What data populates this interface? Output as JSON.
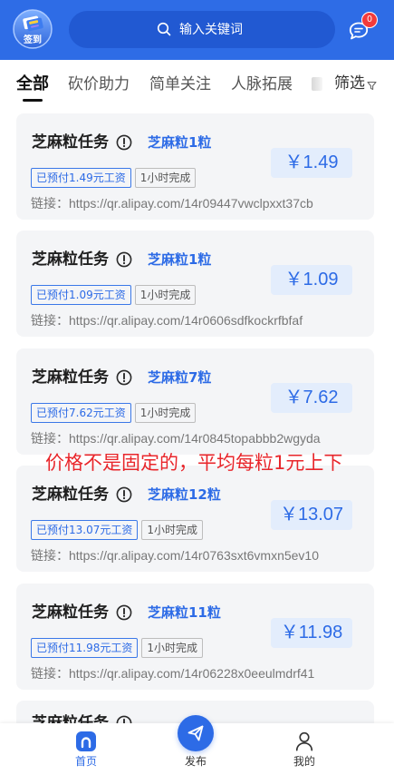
{
  "header": {
    "checkin_label": "签到",
    "search_placeholder": "输入关键词",
    "message_badge": "0",
    "icons": [
      "checkin-icon",
      "search-icon",
      "message-icon"
    ]
  },
  "tabs": {
    "items": [
      {
        "label": "全部",
        "active": true
      },
      {
        "label": "砍价助力"
      },
      {
        "label": "简单关注"
      },
      {
        "label": "人脉拓展"
      }
    ],
    "filter_label": "筛选"
  },
  "cards": [
    {
      "title": "芝麻粒任务",
      "reward": "芝麻粒1粒",
      "prepaid": "已预付1.49元工资",
      "duration": "1小时完成",
      "link_label": "链接：",
      "link_url": "https://qr.alipay.com/14r09447vwclpxxt37cb",
      "price": "￥1.49"
    },
    {
      "title": "芝麻粒任务",
      "reward": "芝麻粒1粒",
      "prepaid": "已预付1.09元工资",
      "duration": "1小时完成",
      "link_label": "链接：",
      "link_url": "https://qr.alipay.com/14r0606sdfkockrfbfaf",
      "price": "￥1.09"
    },
    {
      "title": "芝麻粒任务",
      "reward": "芝麻粒7粒",
      "prepaid": "已预付7.62元工资",
      "duration": "1小时完成",
      "link_label": "链接：",
      "link_url": "https://qr.alipay.com/14r0845topabbb2wgyda",
      "price": "￥7.62"
    },
    {
      "title": "芝麻粒任务",
      "reward": "芝麻粒12粒",
      "prepaid": "已预付13.07元工资",
      "duration": "1小时完成",
      "link_label": "链接：",
      "link_url": "https://qr.alipay.com/14r0763sxt6vmxn5ev10",
      "price": "￥13.07"
    },
    {
      "title": "芝麻粒任务",
      "reward": "芝麻粒11粒",
      "prepaid": "已预付11.98元工资",
      "duration": "1小时完成",
      "link_label": "链接：",
      "link_url": "https://qr.alipay.com/14r06228x0eeulmdrf41",
      "price": "￥11.98"
    },
    {
      "title": "芝麻粒任务"
    }
  ],
  "overlay_note": "价格不是固定的，平均每粒1元上下",
  "bottom_nav": {
    "items": [
      {
        "label": "首页",
        "icon": "home-icon",
        "active": true
      },
      {
        "label": "发布",
        "icon": "paper-plane-icon"
      },
      {
        "label": "我的",
        "icon": "person-icon"
      }
    ]
  },
  "colors": {
    "brand_blue": "#2e6ce6",
    "price_bg": "#e3edfc",
    "note_red": "#e8262b",
    "badge_red": "#f23b3b"
  }
}
